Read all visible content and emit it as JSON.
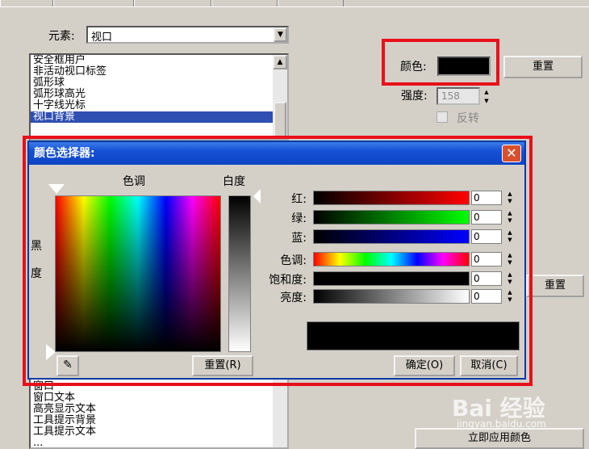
{
  "top": {
    "element_label": "元素:",
    "element_value": "视口",
    "list_items": [
      "安全框用户",
      "非活动视口标签",
      "弧形球",
      "弧形球高光",
      "十字线光标",
      "视口背景"
    ],
    "list_items_bottom": [
      "窗口",
      "窗口文本",
      "高亮显示文本",
      "工具提示背景",
      "工具提示文本",
      "..."
    ],
    "color_label": "颜色:",
    "color_value": "#000000",
    "reset_label": "重置",
    "intensity_label": "强度:",
    "intensity_value": "158",
    "invert_label": "反转",
    "reset2_label": "重置",
    "apply_label": "立即应用颜色"
  },
  "dialog": {
    "title": "颜色选择器:",
    "hue_label": "色调",
    "white_label": "白度",
    "black_label_1": "黑",
    "black_label_2": "度",
    "reset_label": "重置(R)",
    "ok_label": "确定(O)",
    "cancel_label": "取消(C)",
    "channels": [
      {
        "label": "红:",
        "value": "0"
      },
      {
        "label": "绿:",
        "value": "0"
      },
      {
        "label": "蓝:",
        "value": "0"
      },
      {
        "label": "色调:",
        "value": "0"
      },
      {
        "label": "饱和度:",
        "value": "0"
      },
      {
        "label": "亮度:",
        "value": "0"
      }
    ],
    "preview_color": "#000000"
  },
  "watermark": {
    "brand": "Bai 经验",
    "url": "jingyan.baidu.com"
  },
  "colors": {
    "highlight_red": "#e8101a",
    "selection_blue": "#2f4fb2",
    "title_blue": "#1450d6"
  }
}
